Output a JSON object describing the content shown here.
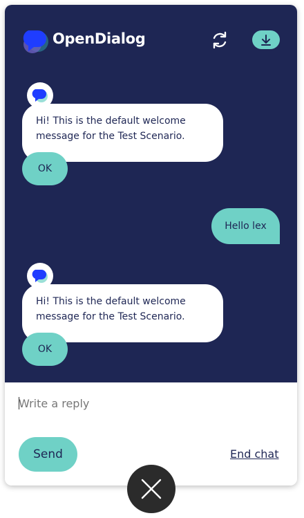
{
  "header": {
    "brand_name": "OpenDialog",
    "logo_icon": "opendialog-logo-icon",
    "refresh_icon": "refresh-icon",
    "download_icon": "download-icon"
  },
  "messages": [
    {
      "from": "bot",
      "text": "Hi! This is the default welcome message for the Test Scenario.",
      "button": "OK"
    },
    {
      "from": "user",
      "text": "Hello lex"
    },
    {
      "from": "bot",
      "text": "Hi! This is the default welcome message for the Test Scenario.",
      "button": "OK"
    }
  ],
  "composer": {
    "placeholder": "Write a reply",
    "send_label": "Send",
    "end_chat_label": "End chat"
  },
  "close_icon": "close-icon",
  "colors": {
    "chat_background": "#1e2654",
    "accent": "#6fd1c6",
    "bubble_background": "#ffffff",
    "close_button": "#2b2b2b"
  }
}
